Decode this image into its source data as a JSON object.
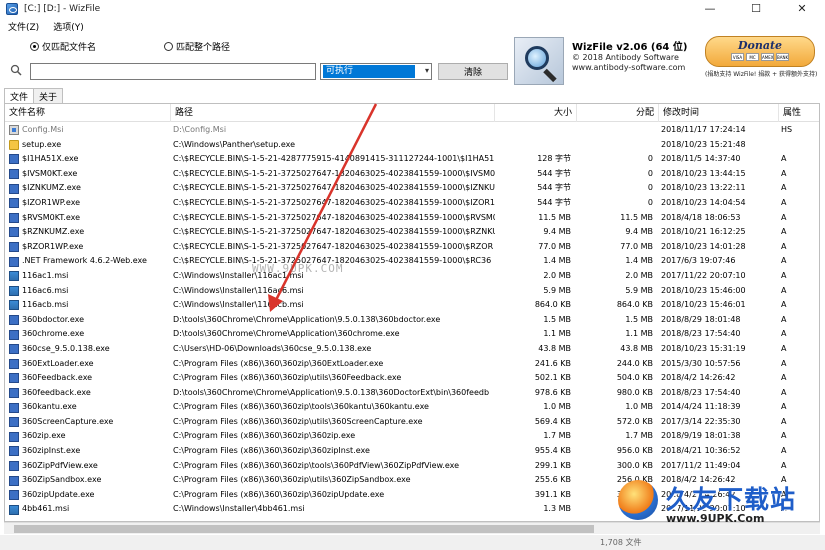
{
  "window": {
    "title": "[C:] [D:]  - WizFile",
    "controls": [
      "—",
      "☐",
      "✕"
    ]
  },
  "menu": [
    "文件(Z)",
    "选项(Y)"
  ],
  "search": {
    "radio_filename": "仅匹配文件名",
    "radio_fullpath": "匹配整个路径",
    "input_value": "",
    "filter_value": "可执行",
    "clear_label": "清除"
  },
  "about": {
    "title": "WizFile v2.06 (64 位)",
    "line1": "© 2018 Antibody Software",
    "line2": "www.antibody-software.com",
    "donate_label": "Donate",
    "cards": [
      "VISA",
      "MC",
      "AMEX",
      "BANK"
    ],
    "donate_note": "(捐助支持 WizFile! 捐款 + 获得额外支持)"
  },
  "tabs": [
    "文件",
    "关于"
  ],
  "columns": {
    "name": "文件名称",
    "path": "路径",
    "size": "大小",
    "alloc": "分配",
    "mtime": "修改时间",
    "attr": "属性"
  },
  "rows": [
    {
      "icon": "msi",
      "name": "Config.Msi",
      "path": "D:\\Config.Msi",
      "size": "",
      "alloc": "",
      "mtime": "2018/11/17 17:24:14",
      "attr": "HS",
      "dim": true
    },
    {
      "icon": "folder",
      "name": "setup.exe",
      "path": "C:\\Windows\\Panther\\setup.exe",
      "size": "",
      "alloc": "",
      "mtime": "2018/10/23 15:21:48",
      "attr": "",
      "dim": false
    },
    {
      "icon": "exe",
      "name": "$I1HA51X.exe",
      "path": "C:\\$RECYCLE.BIN\\S-1-5-21-4287775915-4140891415-311127244-1001\\$I1HA51",
      "size": "128 字节",
      "alloc": "0",
      "mtime": "2018/11/5 14:37:40",
      "attr": "A",
      "dim": false
    },
    {
      "icon": "exe",
      "name": "$IVSM0KT.exe",
      "path": "C:\\$RECYCLE.BIN\\S-1-5-21-3725027647-1820463025-4023841559-1000\\$IVSM0",
      "size": "544 字节",
      "alloc": "0",
      "mtime": "2018/10/23 13:44:15",
      "attr": "A",
      "dim": false
    },
    {
      "icon": "exe",
      "name": "$IZNKUMZ.exe",
      "path": "C:\\$RECYCLE.BIN\\S-1-5-21-3725027647-1820463025-4023841559-1000\\$IZNKU",
      "size": "544 字节",
      "alloc": "0",
      "mtime": "2018/10/23 13:22:11",
      "attr": "A",
      "dim": false
    },
    {
      "icon": "exe",
      "name": "$IZOR1WP.exe",
      "path": "C:\\$RECYCLE.BIN\\S-1-5-21-3725027647-1820463025-4023841559-1000\\$IZOR1",
      "size": "544 字节",
      "alloc": "0",
      "mtime": "2018/10/23 14:04:54",
      "attr": "A",
      "dim": false
    },
    {
      "icon": "exe",
      "name": "$RVSM0KT.exe",
      "path": "C:\\$RECYCLE.BIN\\S-1-5-21-3725027647-1820463025-4023841559-1000\\$RVSM0",
      "size": "11.5 MB",
      "alloc": "11.5 MB",
      "mtime": "2018/4/18 18:06:53",
      "attr": "A",
      "dim": false
    },
    {
      "icon": "exe",
      "name": "$RZNKUMZ.exe",
      "path": "C:\\$RECYCLE.BIN\\S-1-5-21-3725027647-1820463025-4023841559-1000\\$RZNKU",
      "size": "9.4 MB",
      "alloc": "9.4 MB",
      "mtime": "2018/10/21 16:12:25",
      "attr": "A",
      "dim": false
    },
    {
      "icon": "exe",
      "name": "$RZOR1WP.exe",
      "path": "C:\\$RECYCLE.BIN\\S-1-5-21-3725027647-1820463025-4023841559-1000\\$RZOR",
      "size": "77.0 MB",
      "alloc": "77.0 MB",
      "mtime": "2018/10/23 14:01:28",
      "attr": "A",
      "dim": false
    },
    {
      "icon": "exe",
      "name": ".NET Framework 4.6.2-Web.exe",
      "path": "C:\\$RECYCLE.BIN\\S-1-5-21-3725027647-1820463025-4023841559-1000\\$RC36",
      "size": "1.4 MB",
      "alloc": "1.4 MB",
      "mtime": "2017/6/3 19:07:46",
      "attr": "A",
      "dim": false
    },
    {
      "icon": "pkg",
      "name": "116ac1.msi",
      "path": "C:\\Windows\\Installer\\116ac1.msi",
      "size": "2.0 MB",
      "alloc": "2.0 MB",
      "mtime": "2017/11/22 20:07:10",
      "attr": "A",
      "dim": false
    },
    {
      "icon": "pkg",
      "name": "116ac6.msi",
      "path": "C:\\Windows\\Installer\\116ac6.msi",
      "size": "5.9 MB",
      "alloc": "5.9 MB",
      "mtime": "2018/10/23 15:46:00",
      "attr": "A",
      "dim": false
    },
    {
      "icon": "pkg",
      "name": "116acb.msi",
      "path": "C:\\Windows\\Installer\\116acb.msi",
      "size": "864.0 KB",
      "alloc": "864.0 KB",
      "mtime": "2018/10/23 15:46:01",
      "attr": "A",
      "dim": false
    },
    {
      "icon": "exe",
      "name": "360bdoctor.exe",
      "path": "D:\\tools\\360Chrome\\Chrome\\Application\\9.5.0.138\\360bdoctor.exe",
      "size": "1.5 MB",
      "alloc": "1.5 MB",
      "mtime": "2018/8/29 18:01:48",
      "attr": "A",
      "dim": false
    },
    {
      "icon": "exe",
      "name": "360chrome.exe",
      "path": "D:\\tools\\360Chrome\\Chrome\\Application\\360chrome.exe",
      "size": "1.1 MB",
      "alloc": "1.1 MB",
      "mtime": "2018/8/23 17:54:40",
      "attr": "A",
      "dim": false
    },
    {
      "icon": "exe",
      "name": "360cse_9.5.0.138.exe",
      "path": "C:\\Users\\HD-06\\Downloads\\360cse_9.5.0.138.exe",
      "size": "43.8 MB",
      "alloc": "43.8 MB",
      "mtime": "2018/10/23 15:31:19",
      "attr": "A",
      "dim": false
    },
    {
      "icon": "exe",
      "name": "360ExtLoader.exe",
      "path": "C:\\Program Files (x86)\\360\\360zip\\360ExtLoader.exe",
      "size": "241.6 KB",
      "alloc": "244.0 KB",
      "mtime": "2015/3/30 10:57:56",
      "attr": "A",
      "dim": false
    },
    {
      "icon": "exe",
      "name": "360Feedback.exe",
      "path": "C:\\Program Files (x86)\\360\\360zip\\utils\\360Feedback.exe",
      "size": "502.1 KB",
      "alloc": "504.0 KB",
      "mtime": "2018/4/2 14:26:42",
      "attr": "A",
      "dim": false
    },
    {
      "icon": "exe",
      "name": "360feedback.exe",
      "path": "D:\\tools\\360Chrome\\Chrome\\Application\\9.5.0.138\\360DoctorExt\\bin\\360feedb",
      "size": "978.6 KB",
      "alloc": "980.0 KB",
      "mtime": "2018/8/23 17:54:40",
      "attr": "A",
      "dim": false
    },
    {
      "icon": "exe",
      "name": "360kantu.exe",
      "path": "C:\\Program Files (x86)\\360\\360zip\\tools\\360kantu\\360kantu.exe",
      "size": "1.0 MB",
      "alloc": "1.0 MB",
      "mtime": "2014/4/24 11:18:39",
      "attr": "A",
      "dim": false
    },
    {
      "icon": "exe",
      "name": "360ScreenCapture.exe",
      "path": "C:\\Program Files (x86)\\360\\360zip\\utils\\360ScreenCapture.exe",
      "size": "569.4 KB",
      "alloc": "572.0 KB",
      "mtime": "2017/3/14 22:35:30",
      "attr": "A",
      "dim": false
    },
    {
      "icon": "exe",
      "name": "360zip.exe",
      "path": "C:\\Program Files (x86)\\360\\360zip\\360zip.exe",
      "size": "1.7 MB",
      "alloc": "1.7 MB",
      "mtime": "2018/9/19 18:01:38",
      "attr": "A",
      "dim": false
    },
    {
      "icon": "exe",
      "name": "360zipInst.exe",
      "path": "C:\\Program Files (x86)\\360\\360zip\\360zipInst.exe",
      "size": "955.4 KB",
      "alloc": "956.0 KB",
      "mtime": "2018/4/21 10:36:52",
      "attr": "A",
      "dim": false
    },
    {
      "icon": "exe",
      "name": "360ZipPdfView.exe",
      "path": "C:\\Program Files (x86)\\360\\360zip\\tools\\360PdfView\\360ZipPdfView.exe",
      "size": "299.1 KB",
      "alloc": "300.0 KB",
      "mtime": "2017/11/2 11:49:04",
      "attr": "A",
      "dim": false
    },
    {
      "icon": "exe",
      "name": "360ZipSandbox.exe",
      "path": "C:\\Program Files (x86)\\360\\360zip\\utils\\360ZipSandbox.exe",
      "size": "255.6 KB",
      "alloc": "256.0 KB",
      "mtime": "2018/4/2 14:26:42",
      "attr": "A",
      "dim": false
    },
    {
      "icon": "exe",
      "name": "360zipUpdate.exe",
      "path": "C:\\Program Files (x86)\\360\\360zip\\360zipUpdate.exe",
      "size": "391.1 KB",
      "alloc": "392.0 KB",
      "mtime": "2018/4/2 14:26:42",
      "attr": "A",
      "dim": false
    },
    {
      "icon": "pkg",
      "name": "4bb461.msi",
      "path": "C:\\Windows\\Installer\\4bb461.msi",
      "size": "1.3 MB",
      "alloc": "1.3 MB",
      "mtime": "2017/11/22 20:07:10",
      "attr": "A",
      "dim": false
    }
  ],
  "status": "1,708 文件",
  "watermark": {
    "center": "WWW.9UPK.COM",
    "brand": "久友下载站",
    "url": "www.9UPK.Com"
  },
  "colors": {
    "selection": "#0078d7",
    "annotation_arrow": "#d9342b",
    "brand_blue": "#1f5ec9"
  }
}
